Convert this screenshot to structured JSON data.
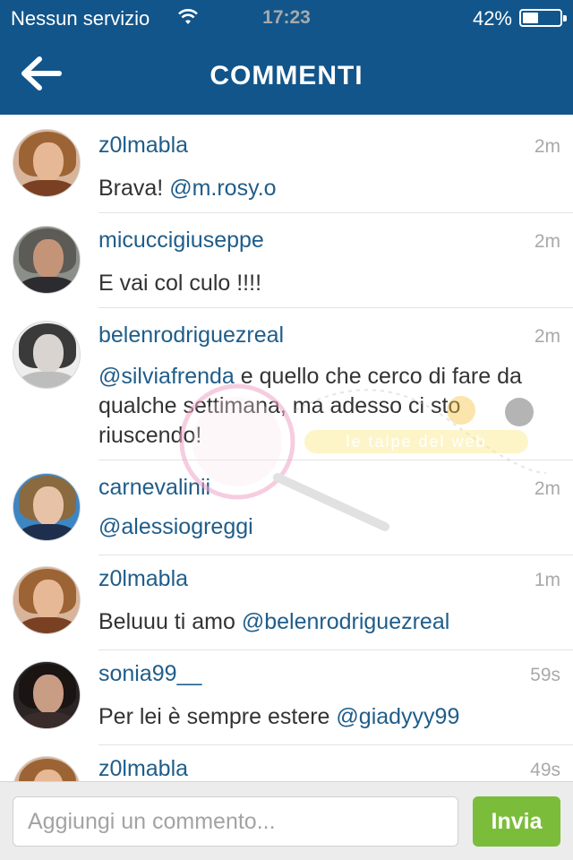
{
  "status_bar": {
    "carrier": "Nessun servizio",
    "time": "17:23",
    "battery_percent": "42%",
    "battery_level": 0.42
  },
  "nav": {
    "title": "COMMENTI",
    "back_icon": "arrow-left-icon"
  },
  "comments": [
    {
      "username": "z0lmabla",
      "time": "2m",
      "text": "Brava! ",
      "mention": "@m.rosy.o",
      "after": ""
    },
    {
      "username": "micuccigiuseppe",
      "time": "2m",
      "text": "E vai col culo !!!!",
      "mention": "",
      "after": ""
    },
    {
      "username": "belenrodriguezreal",
      "time": "2m",
      "text": "",
      "mention": "@silviafrenda",
      "after": " e quello che cerco di fare da qualche settimana, ma adesso ci sto riuscendo!"
    },
    {
      "username": "carnevalinii",
      "time": "2m",
      "text": "",
      "mention": "@alessiogreggi",
      "after": ""
    },
    {
      "username": "z0lmabla",
      "time": "1m",
      "text": "Beluuu ti amo ",
      "mention": "@belenrodriguezreal",
      "after": ""
    },
    {
      "username": "sonia99__",
      "time": "59s",
      "text": "Per lei è sempre estere ",
      "mention": "@giadyyy99",
      "after": ""
    },
    {
      "username": "z0lmabla",
      "time": "49s",
      "text": "",
      "mention": "",
      "after": ""
    }
  ],
  "watermark": {
    "text": "le talpe del web"
  },
  "composer": {
    "placeholder": "Aggiungi un commento...",
    "send_label": "Invia"
  },
  "colors": {
    "header": "#12558a",
    "username": "#1f5d8a",
    "send_button": "#7bbd3a"
  }
}
